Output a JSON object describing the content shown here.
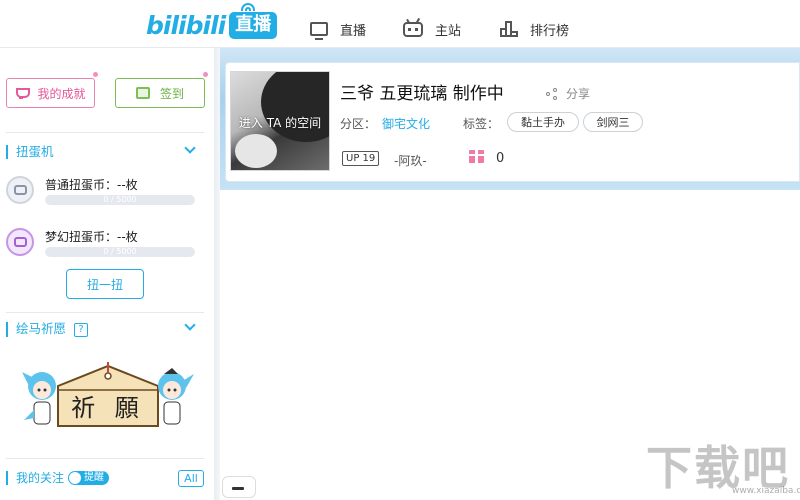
{
  "header": {
    "logo_text": "bilibili",
    "logo_badge": "直播",
    "nav": [
      {
        "label": "直播",
        "icon": "tv-icon"
      },
      {
        "label": "主站",
        "icon": "bilibili-icon"
      },
      {
        "label": "排行榜",
        "icon": "ranking-icon"
      }
    ]
  },
  "sidebar": {
    "achievements_label": "我的成就",
    "sign_in_label": "签到",
    "capsule": {
      "title": "扭蛋机",
      "coins": [
        {
          "label": "普通扭蛋币：--枚",
          "progress_text": "0 / 5000",
          "progress_fraction": 0
        },
        {
          "label": "梦幻扭蛋币：--枚",
          "progress_text": "0 / 5000",
          "progress_fraction": 0
        }
      ],
      "button_label": "扭一扭"
    },
    "wish": {
      "title": "绘马祈愿",
      "help": "?",
      "board_text": "祈 願"
    },
    "following": {
      "title": "我的关注",
      "toggle_label": "提醒",
      "all_label": "All"
    }
  },
  "room": {
    "cover_overlay": "进入 TA 的空间",
    "title": "三爷 五更琉璃 制作中",
    "share_label": "分享",
    "area_label": "分区：",
    "area_value": "御宅文化",
    "tags_label": "标签：",
    "tags": [
      "黏土手办",
      "剑网三"
    ],
    "up_badge": "UP 19",
    "up_name": "-阿玖-",
    "gift_count": "0"
  },
  "watermark": {
    "text": "下载吧",
    "url": "www.xiazaiba.com"
  },
  "colors": {
    "accent": "#23ade5",
    "pink": "#e5589a",
    "green": "#6cb043"
  }
}
